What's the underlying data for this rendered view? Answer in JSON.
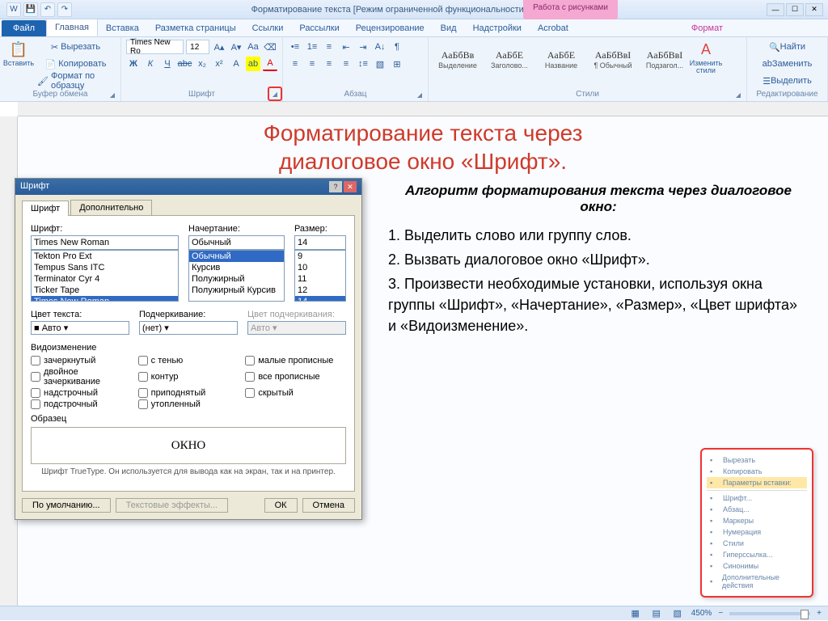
{
  "titlebar": {
    "doc_title": "Форматирование текста [Режим ограниченной функциональности] - Microsoft Word",
    "pic_tools": "Работа с рисунками"
  },
  "tabs": {
    "file": "Файл",
    "items": [
      "Главная",
      "Вставка",
      "Разметка страницы",
      "Ссылки",
      "Рассылки",
      "Рецензирование",
      "Вид",
      "Надстройки",
      "Acrobat"
    ],
    "format": "Формат"
  },
  "ribbon": {
    "clipboard": {
      "label": "Буфер обмена",
      "paste": "Вставить",
      "cut": "Вырезать",
      "copy": "Копировать",
      "painter": "Формат по образцу"
    },
    "font": {
      "label": "Шрифт",
      "name": "Times New Ro",
      "size": "12"
    },
    "para": {
      "label": "Абзац"
    },
    "styles": {
      "label": "Стили",
      "items": [
        {
          "prev": "АаБбВв",
          "name": "Выделение"
        },
        {
          "prev": "АаБбЕ",
          "name": "Заголово..."
        },
        {
          "prev": "АаБбЕ",
          "name": "Название"
        },
        {
          "prev": "АаБбВвІ",
          "name": "¶ Обычный"
        },
        {
          "prev": "АаБбВвІ",
          "name": "Подзагол..."
        }
      ],
      "change": "Изменить стили"
    },
    "editing": {
      "label": "Редактирование",
      "find": "Найти",
      "replace": "Заменить",
      "select": "Выделить"
    }
  },
  "page": {
    "heading_l1": "Форматирование текста через",
    "heading_l2": "диалоговое окно «Шрифт»."
  },
  "algo": {
    "title": "Алгоритм форматирования текста через диалоговое окно:",
    "steps": [
      "1. Выделить слово или группу слов.",
      "2. Вызвать диалоговое окно «Шрифт».",
      "3. Произвести необходимые установки, используя окна группы «Шрифт», «Начертание», «Размер», «Цвет шрифта» и «Видоизменение»."
    ]
  },
  "dialog": {
    "title": "Шрифт",
    "tab_font": "Шрифт",
    "tab_adv": "Дополнительно",
    "lbl_font": "Шрифт:",
    "lbl_style": "Начертание:",
    "lbl_size": "Размер:",
    "font_value": "Times New Roman",
    "style_value": "Обычный",
    "size_value": "14",
    "font_list": [
      "Tekton Pro Ext",
      "Tempus Sans ITC",
      "Terminator Cyr 4",
      "Ticker Tape",
      "Times New Roman"
    ],
    "style_list": [
      "Обычный",
      "Курсив",
      "Полужирный",
      "Полужирный Курсив"
    ],
    "size_list": [
      "9",
      "10",
      "11",
      "12",
      "14"
    ],
    "lbl_color": "Цвет текста:",
    "lbl_underline": "Подчеркивание:",
    "lbl_ucolor": "Цвет подчеркивания:",
    "color_val": "Авто",
    "underline_val": "(нет)",
    "ucolor_val": "Авто",
    "section_effects": "Видоизменение",
    "checks": [
      "зачеркнутый",
      "с тенью",
      "малые прописные",
      "двойное зачеркивание",
      "контур",
      "все прописные",
      "надстрочный",
      "приподнятый",
      "скрытый",
      "подстрочный",
      "утопленный"
    ],
    "section_preview": "Образец",
    "preview_text": "ОКНО",
    "hint": "Шрифт TrueType. Он используется для вывода как на экран, так и на принтер.",
    "btn_default": "По умолчанию...",
    "btn_effects": "Текстовые эффекты...",
    "btn_ok": "ОК",
    "btn_cancel": "Отмена"
  },
  "minimenu": {
    "items": [
      "Вырезать",
      "Копировать",
      "Параметры вставки:",
      "",
      "Шрифт...",
      "Абзац...",
      "Маркеры",
      "Нумерация",
      "Стили",
      "Гиперссылка...",
      "Синонимы",
      "Дополнительные действия"
    ]
  },
  "status": {
    "zoom": "450%"
  }
}
